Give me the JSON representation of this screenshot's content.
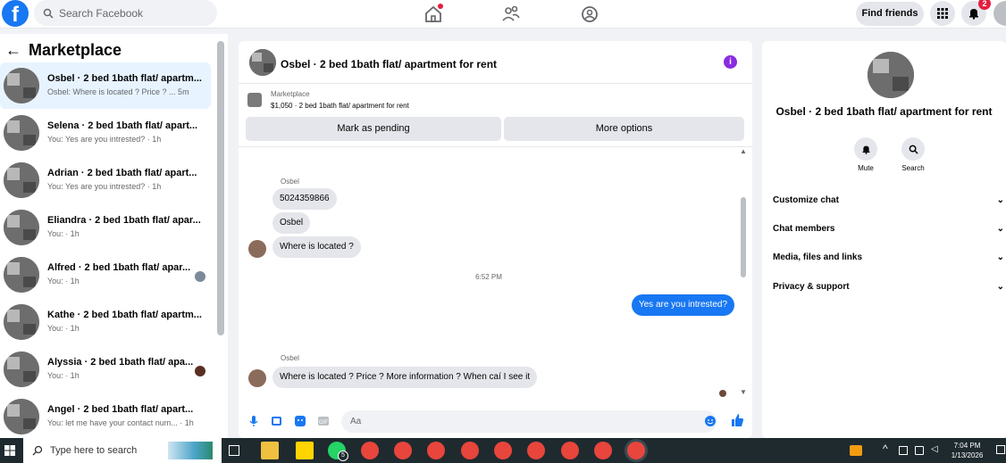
{
  "topbar": {
    "logo": "f",
    "search_placeholder": "Search Facebook",
    "find_friends": "Find friends",
    "notification_count": "2"
  },
  "left": {
    "title": "Marketplace",
    "conversations": [
      {
        "name": "Osbel · 2 bed 1bath flat/ apartm...",
        "sub": "Osbel: Where is located ? Price ? ...  5m"
      },
      {
        "name": "Selena · 2 bed 1bath flat/ apart...",
        "sub": "You: Yes are you intrested? · 1h"
      },
      {
        "name": "Adrian · 2 bed 1bath flat/ apart...",
        "sub": "You: Yes are you intrested? · 1h"
      },
      {
        "name": "Eliandra · 2 bed 1bath flat/ apar...",
        "sub": "You:  · 1h"
      },
      {
        "name": "Alfred · 2 bed 1bath flat/ apar...",
        "sub": "You:  · 1h"
      },
      {
        "name": "Kathe · 2 bed 1bath flat/ apartm...",
        "sub": "You:  · 1h"
      },
      {
        "name": "Alyssia · 2 bed 1bath flat/ apa...",
        "sub": "You:  · 1h"
      },
      {
        "name": "Angel · 2 bed 1bath flat/ apart...",
        "sub": "You: let me have your contact num... · 1h"
      }
    ]
  },
  "chat": {
    "title": "Osbel · 2 bed 1bath flat/ apartment for rent",
    "marketplace_label": "Marketplace",
    "listing": "$1,050 · 2 bed 1bath flat/ apartment for rent",
    "mark_pending": "Mark as pending",
    "more_options": "More options",
    "sender1": "Osbel",
    "msg1": "5024359866",
    "msg2": "Osbel",
    "msg3": "Where is located ?",
    "time": "6:52 PM",
    "my_msg": "Yes are you intrested?",
    "sender2": "Osbel",
    "msg4": "Where is located ? Price ? More information ? When caí I see it",
    "composer_placeholder": "Aa"
  },
  "right": {
    "title": "Osbel · 2 bed 1bath flat/ apartment for rent",
    "mute": "Mute",
    "search": "Search",
    "items": [
      "Customize chat",
      "Chat members",
      "Media, files and links",
      "Privacy & support"
    ]
  },
  "taskbar": {
    "search_placeholder": "Type here to search",
    "time": "7:04 PM",
    "date": "1/13/2026",
    "whatsapp_badge": "5"
  }
}
